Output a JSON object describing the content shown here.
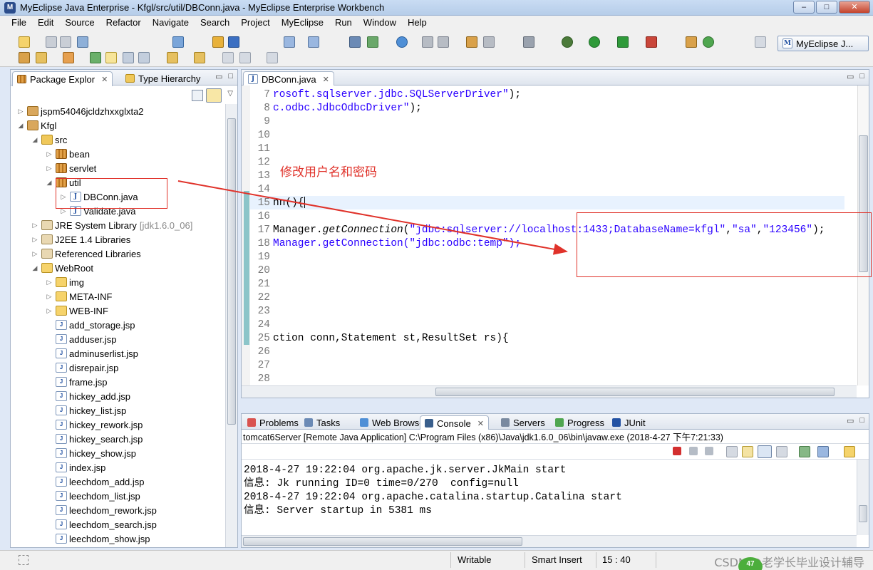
{
  "window": {
    "title": "MyEclipse Java Enterprise - Kfgl/src/util/DBConn.java - MyEclipse Enterprise Workbench",
    "buttons": {
      "minimize": "–",
      "maximize": "□",
      "close": "✕"
    }
  },
  "menu": [
    "File",
    "Edit",
    "Source",
    "Refactor",
    "Navigate",
    "Search",
    "Project",
    "MyEclipse",
    "Run",
    "Window",
    "Help"
  ],
  "toolbar": {
    "perspective_label": "MyEclipse J..."
  },
  "explorer": {
    "tabs": [
      {
        "label": "Package Explor",
        "active": true
      },
      {
        "label": "Type Hierarchy",
        "active": false
      }
    ],
    "tree": [
      {
        "label": "jspm54046jcldzhxxglxta2",
        "depth": 0,
        "expanded": false,
        "icon": "project-icon"
      },
      {
        "label": "Kfgl",
        "depth": 0,
        "expanded": true,
        "icon": "project-icon"
      },
      {
        "label": "src",
        "depth": 1,
        "expanded": true,
        "icon": "source-folder-icon"
      },
      {
        "label": "bean",
        "depth": 2,
        "expanded": false,
        "icon": "package-icon"
      },
      {
        "label": "servlet",
        "depth": 2,
        "expanded": false,
        "icon": "package-icon"
      },
      {
        "label": "util",
        "depth": 2,
        "expanded": true,
        "icon": "package-icon"
      },
      {
        "label": "DBConn.java",
        "depth": 3,
        "expanded": false,
        "icon": "java-file-icon"
      },
      {
        "label": "Validate.java",
        "depth": 3,
        "expanded": false,
        "icon": "java-file-icon"
      },
      {
        "label": "JRE System Library",
        "suffix": "[jdk1.6.0_06]",
        "depth": 1,
        "expanded": false,
        "icon": "library-icon"
      },
      {
        "label": "J2EE 1.4 Libraries",
        "depth": 1,
        "expanded": false,
        "icon": "library-icon"
      },
      {
        "label": "Referenced Libraries",
        "depth": 1,
        "expanded": false,
        "icon": "library-icon"
      },
      {
        "label": "WebRoot",
        "depth": 1,
        "expanded": true,
        "icon": "folder-icon"
      },
      {
        "label": "img",
        "depth": 2,
        "expanded": false,
        "icon": "folder-icon"
      },
      {
        "label": "META-INF",
        "depth": 2,
        "expanded": false,
        "icon": "folder-icon"
      },
      {
        "label": "WEB-INF",
        "depth": 2,
        "expanded": false,
        "icon": "folder-icon"
      },
      {
        "label": "add_storage.jsp",
        "depth": 2,
        "icon": "jsp-file-icon"
      },
      {
        "label": "adduser.jsp",
        "depth": 2,
        "icon": "jsp-file-icon"
      },
      {
        "label": "adminuserlist.jsp",
        "depth": 2,
        "icon": "jsp-file-icon"
      },
      {
        "label": "disrepair.jsp",
        "depth": 2,
        "icon": "jsp-file-icon"
      },
      {
        "label": "frame.jsp",
        "depth": 2,
        "icon": "jsp-file-icon"
      },
      {
        "label": "hickey_add.jsp",
        "depth": 2,
        "icon": "jsp-file-icon"
      },
      {
        "label": "hickey_list.jsp",
        "depth": 2,
        "icon": "jsp-file-icon"
      },
      {
        "label": "hickey_rework.jsp",
        "depth": 2,
        "icon": "jsp-file-icon"
      },
      {
        "label": "hickey_search.jsp",
        "depth": 2,
        "icon": "jsp-file-icon"
      },
      {
        "label": "hickey_show.jsp",
        "depth": 2,
        "icon": "jsp-file-icon"
      },
      {
        "label": "index.jsp",
        "depth": 2,
        "icon": "jsp-file-icon"
      },
      {
        "label": "leechdom_add.jsp",
        "depth": 2,
        "icon": "jsp-file-icon"
      },
      {
        "label": "leechdom_list.jsp",
        "depth": 2,
        "icon": "jsp-file-icon"
      },
      {
        "label": "leechdom_rework.jsp",
        "depth": 2,
        "icon": "jsp-file-icon"
      },
      {
        "label": "leechdom_search.jsp",
        "depth": 2,
        "icon": "jsp-file-icon"
      },
      {
        "label": "leechdom_show.jsp",
        "depth": 2,
        "icon": "jsp-file-icon"
      }
    ]
  },
  "editor": {
    "tab_label": "DBConn.java",
    "lines": [
      {
        "num": "7",
        "segments": [
          {
            "t": "rosoft.sqlserver.jdbc.SQLServerDriver\"",
            "c": "str"
          },
          {
            "t": ");",
            "c": ""
          }
        ]
      },
      {
        "num": "8",
        "segments": [
          {
            "t": "c.odbc.JdbcOdbcDriver\"",
            "c": "str"
          },
          {
            "t": ");",
            "c": ""
          }
        ]
      },
      {
        "num": "9",
        "segments": []
      },
      {
        "num": "10",
        "segments": []
      },
      {
        "num": "11",
        "segments": []
      },
      {
        "num": "12",
        "segments": []
      },
      {
        "num": "13",
        "segments": []
      },
      {
        "num": "14",
        "segments": []
      },
      {
        "num": "15",
        "segments": [
          {
            "t": "nn(){",
            "c": ""
          }
        ],
        "highlight": true,
        "caret": true
      },
      {
        "num": "16",
        "segments": []
      },
      {
        "num": "17",
        "segments": [
          {
            "t": "Manager.",
            "c": ""
          },
          {
            "t": "getConnection",
            "c": "italic"
          },
          {
            "t": "(",
            "c": ""
          },
          {
            "t": "\"jdbc:sqlserver://localhost:1433;DatabaseName=kfgl\"",
            "c": "str"
          },
          {
            "t": ",",
            "c": ""
          },
          {
            "t": "\"sa\"",
            "c": "str"
          },
          {
            "t": ",",
            "c": ""
          },
          {
            "t": "\"123456\"",
            "c": "str"
          },
          {
            "t": ");",
            "c": ""
          }
        ]
      },
      {
        "num": "18",
        "segments": [
          {
            "t": "Manager.getConnection(\"jdbc:odbc:temp\");",
            "c": "str"
          }
        ]
      },
      {
        "num": "19",
        "segments": []
      },
      {
        "num": "20",
        "segments": []
      },
      {
        "num": "21",
        "segments": []
      },
      {
        "num": "22",
        "segments": []
      },
      {
        "num": "23",
        "segments": []
      },
      {
        "num": "24",
        "segments": []
      },
      {
        "num": "25",
        "segments": [
          {
            "t": "ction conn,Statement st,ResultSet rs){",
            "c": ""
          }
        ]
      },
      {
        "num": "26",
        "segments": []
      },
      {
        "num": "27",
        "segments": []
      },
      {
        "num": "28",
        "segments": []
      },
      {
        "num": "29",
        "segments": [
          {
            "t": "){",
            "c": ""
          }
        ]
      }
    ]
  },
  "annotation": {
    "text": "修改用户名和密码",
    "color": "#e0322a"
  },
  "bottom_panel": {
    "tabs": [
      {
        "label": "Problems",
        "active": false
      },
      {
        "label": "Tasks",
        "active": false
      },
      {
        "label": "Web Browser",
        "active": false
      },
      {
        "label": "Console",
        "active": true
      },
      {
        "label": "Servers",
        "active": false
      },
      {
        "label": "Progress",
        "active": false
      },
      {
        "label": "JUnit",
        "active": false
      }
    ],
    "description": "tomcat6Server [Remote Java Application] C:\\Program Files (x86)\\Java\\jdk1.6.0_06\\bin\\javaw.exe (2018-4-27 下午7:21:33)",
    "output": [
      "2018-4-27 19:22:04 org.apache.jk.server.JkMain start",
      "信息: Jk running ID=0 time=0/270  config=null",
      "2018-4-27 19:22:04 org.apache.catalina.startup.Catalina start",
      "信息: Server startup in 5381 ms"
    ]
  },
  "status": {
    "writable": "Writable",
    "insert_mode": "Smart Insert",
    "position": "15 : 40",
    "badge": "47"
  },
  "watermark": "CSDN @老学长毕业设计辅导",
  "colors": {
    "accent": "#e0322a",
    "string": "#2a00ff",
    "selection": "#e8f2fe"
  }
}
